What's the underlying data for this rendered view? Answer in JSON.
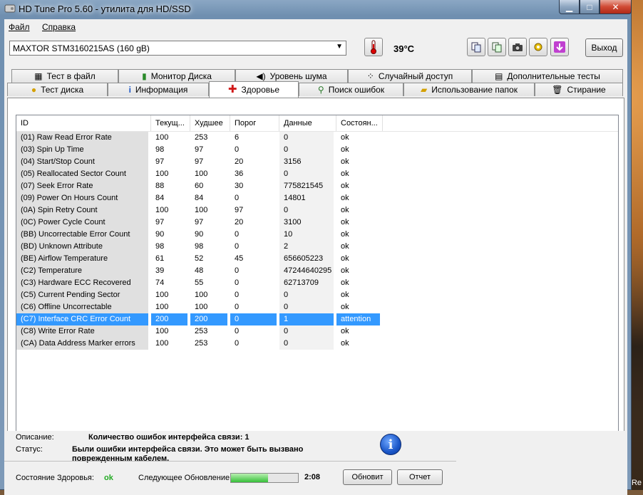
{
  "window": {
    "title": "HD Tune Pro 5.60 - утилита для HD/SSD",
    "app_icon": "disk-icon",
    "caption": {
      "minimize": "▁",
      "maximize": "□",
      "close": "✕"
    }
  },
  "menu": {
    "items": [
      {
        "label": "Файл"
      },
      {
        "label": "Справка"
      }
    ]
  },
  "toolbar": {
    "drive": "MAXTOR STM3160215AS (160 gB)",
    "temperature": "39°C",
    "exit_label": "Выход",
    "tool_icons": [
      "copy-icon",
      "copy-text-icon",
      "camera-icon",
      "options-icon",
      "save-icon"
    ]
  },
  "tabs": {
    "top_row": [
      {
        "label": "Тест в файл",
        "icon": "file-test-icon"
      },
      {
        "label": "Монитор Диска",
        "icon": "monitor-icon"
      },
      {
        "label": "Уровень шума",
        "icon": "speaker-icon"
      },
      {
        "label": "Случайный доступ",
        "icon": "random-icon"
      },
      {
        "label": "Дополнительные  тесты",
        "icon": "extra-tests-icon"
      }
    ],
    "bottom_row": [
      {
        "label": "Тест диска",
        "icon": "lightbulb-icon"
      },
      {
        "label": "Информация",
        "icon": "info-icon"
      },
      {
        "label": "Здоровье",
        "icon": "health-cross-icon",
        "active": true
      },
      {
        "label": "Поиск ошибок",
        "icon": "magnifier-icon"
      },
      {
        "label": "Использование папок",
        "icon": "folder-icon"
      },
      {
        "label": "Стирание",
        "icon": "trash-icon"
      }
    ]
  },
  "smart_table": {
    "columns": [
      "ID",
      "Текущ...",
      "Худшее",
      "Порог",
      "Данные",
      "Состоян..."
    ],
    "rows": [
      {
        "id": "(01) Raw Read Error Rate",
        "current": "100",
        "worst": "253",
        "threshold": "6",
        "data": "0",
        "status": "ok"
      },
      {
        "id": "(03) Spin Up Time",
        "current": "98",
        "worst": "97",
        "threshold": "0",
        "data": "0",
        "status": "ok"
      },
      {
        "id": "(04) Start/Stop Count",
        "current": "97",
        "worst": "97",
        "threshold": "20",
        "data": "3156",
        "status": "ok"
      },
      {
        "id": "(05) Reallocated Sector Count",
        "current": "100",
        "worst": "100",
        "threshold": "36",
        "data": "0",
        "status": "ok"
      },
      {
        "id": "(07) Seek Error Rate",
        "current": "88",
        "worst": "60",
        "threshold": "30",
        "data": "775821545",
        "status": "ok"
      },
      {
        "id": "(09) Power On Hours Count",
        "current": "84",
        "worst": "84",
        "threshold": "0",
        "data": "14801",
        "status": "ok"
      },
      {
        "id": "(0A) Spin Retry Count",
        "current": "100",
        "worst": "100",
        "threshold": "97",
        "data": "0",
        "status": "ok"
      },
      {
        "id": "(0C) Power Cycle Count",
        "current": "97",
        "worst": "97",
        "threshold": "20",
        "data": "3100",
        "status": "ok"
      },
      {
        "id": "(BB) Uncorrectable Error Count",
        "current": "90",
        "worst": "90",
        "threshold": "0",
        "data": "10",
        "status": "ok"
      },
      {
        "id": "(BD) Unknown Attribute",
        "current": "98",
        "worst": "98",
        "threshold": "0",
        "data": "2",
        "status": "ok"
      },
      {
        "id": "(BE) Airflow Temperature",
        "current": "61",
        "worst": "52",
        "threshold": "45",
        "data": "656605223",
        "status": "ok"
      },
      {
        "id": "(C2) Temperature",
        "current": "39",
        "worst": "48",
        "threshold": "0",
        "data": "47244640295",
        "status": "ok"
      },
      {
        "id": "(C3) Hardware ECC Recovered",
        "current": "74",
        "worst": "55",
        "threshold": "0",
        "data": "62713709",
        "status": "ok"
      },
      {
        "id": "(C5) Current Pending Sector",
        "current": "100",
        "worst": "100",
        "threshold": "0",
        "data": "0",
        "status": "ok"
      },
      {
        "id": "(C6) Offline Uncorrectable",
        "current": "100",
        "worst": "100",
        "threshold": "0",
        "data": "0",
        "status": "ok"
      },
      {
        "id": "(C7) Interface CRC Error Count",
        "current": "200",
        "worst": "200",
        "threshold": "0",
        "data": "1",
        "status": "attention",
        "selected": true
      },
      {
        "id": "(C8) Write Error Rate",
        "current": "100",
        "worst": "253",
        "threshold": "0",
        "data": "0",
        "status": "ok"
      },
      {
        "id": "(CA) Data Address Marker errors",
        "current": "100",
        "worst": "253",
        "threshold": "0",
        "data": "0",
        "status": "ok"
      }
    ]
  },
  "details": {
    "description_label": "Описание:",
    "description_value": "Количество ошибок интерфейса связи: 1",
    "status_label": "Статус:",
    "status_value_line1": "Были ошибки интерфейса связи. Это может быть вызвано",
    "status_value_line2": "поврежденным кабелем."
  },
  "statusbar": {
    "health_label": "Состояние Здоровья:",
    "health_value": "ok",
    "next_update_label": "Следующее Обновление:",
    "progress_fraction": 0.55,
    "countdown": "2:08",
    "button1": "Обновит",
    "button2": "Отчет"
  },
  "desktop": {
    "label": "Re"
  },
  "colors": {
    "selection": "#3399ff",
    "health_ok": "#22aa22"
  }
}
